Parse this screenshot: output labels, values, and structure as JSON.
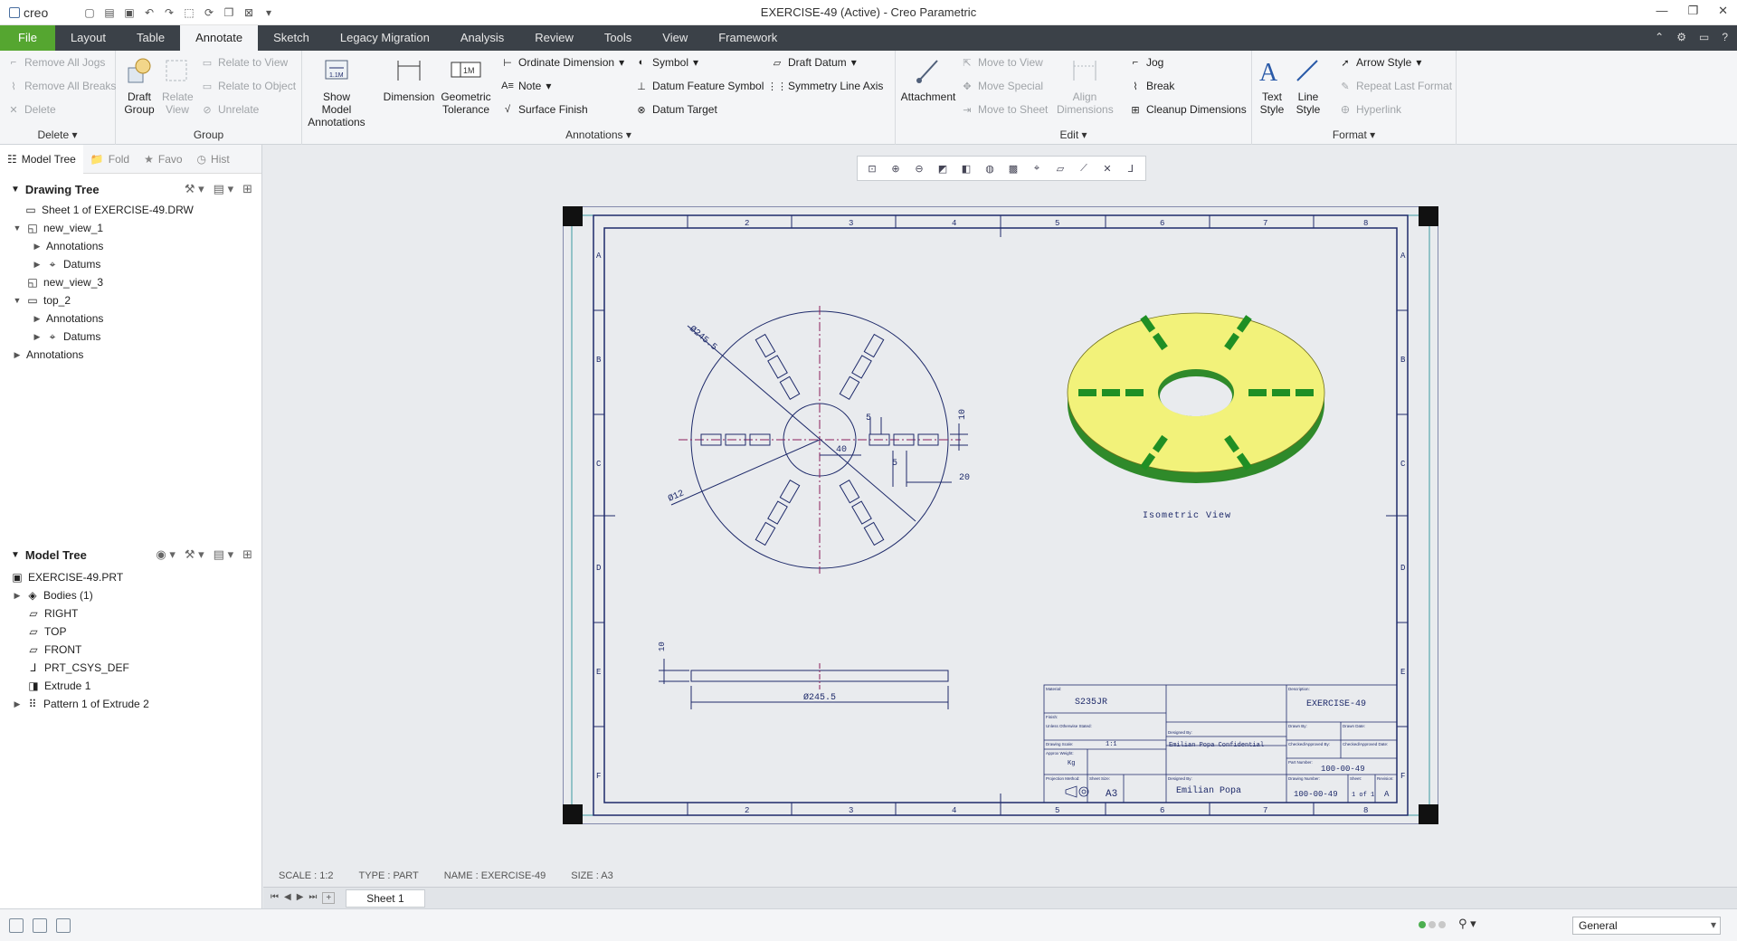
{
  "app": {
    "logo": "creo",
    "window_title": "EXERCISE-49 (Active) - Creo Parametric"
  },
  "tabs": [
    "File",
    "Layout",
    "Table",
    "Annotate",
    "Sketch",
    "Legacy Migration",
    "Analysis",
    "Review",
    "Tools",
    "View",
    "Framework"
  ],
  "ribbon": {
    "delete_group": {
      "label": "Delete",
      "items": [
        "Remove All Jogs",
        "Remove All Breaks",
        "Delete"
      ]
    },
    "group_group": {
      "label": "Group",
      "draft_group": "Draft Group",
      "relate_view": "Relate View",
      "relate_to_view": "Relate to View",
      "relate_to_object": "Relate to Object",
      "unrelate": "Unrelate"
    },
    "annotations_group": {
      "label": "Annotations",
      "show_model_annotations": "Show Model Annotations",
      "dimension": "Dimension",
      "geometric_tolerance": "Geometric Tolerance",
      "ordinate_dimension": "Ordinate Dimension",
      "note": "Note",
      "surface_finish": "Surface Finish",
      "symbol": "Symbol",
      "datum_feature_symbol": "Datum Feature Symbol",
      "datum_target": "Datum Target",
      "draft_datum": "Draft Datum",
      "symmetry_line_axis": "Symmetry Line Axis"
    },
    "edit_group": {
      "label": "Edit",
      "attachment": "Attachment",
      "move_to_view": "Move to View",
      "move_special": "Move Special",
      "move_to_sheet": "Move to Sheet",
      "align_dimensions": "Align Dimensions",
      "jog": "Jog",
      "break": "Break",
      "cleanup_dimensions": "Cleanup Dimensions"
    },
    "format_group": {
      "label": "Format",
      "text_style": "Text Style",
      "line_style": "Line Style",
      "arrow_style": "Arrow Style",
      "repeat_last_format": "Repeat Last Format",
      "hyperlink": "Hyperlink"
    }
  },
  "nav_tabs": [
    "Model Tree",
    "Fold",
    "Favo",
    "Hist"
  ],
  "drawing_tree": {
    "title": "Drawing Tree",
    "items": [
      {
        "label": "Sheet 1 of EXERCISE-49.DRW",
        "level": 0
      },
      {
        "label": "new_view_1",
        "level": 0
      },
      {
        "label": "Annotations",
        "level": 1
      },
      {
        "label": "Datums",
        "level": 1
      },
      {
        "label": "new_view_3",
        "level": 0
      },
      {
        "label": "top_2",
        "level": 0
      },
      {
        "label": "Annotations",
        "level": 1
      },
      {
        "label": "Datums",
        "level": 1
      },
      {
        "label": "Annotations",
        "level": 0
      }
    ]
  },
  "model_tree": {
    "title": "Model Tree",
    "items": [
      {
        "label": "EXERCISE-49.PRT"
      },
      {
        "label": "Bodies (1)"
      },
      {
        "label": "RIGHT"
      },
      {
        "label": "TOP"
      },
      {
        "label": "FRONT"
      },
      {
        "label": "PRT_CSYS_DEF"
      },
      {
        "label": "Extrude 1"
      },
      {
        "label": "Pattern 1 of Extrude 2"
      }
    ]
  },
  "drawing": {
    "columns": [
      "1",
      "2",
      "3",
      "4",
      "5",
      "6",
      "7",
      "8"
    ],
    "rows": [
      "A",
      "B",
      "C",
      "D",
      "E",
      "F"
    ],
    "dims": {
      "dia_outer": "Ø245.5",
      "dia_small": "Ø12",
      "r40": "40",
      "d5a": "5",
      "d5b": "5",
      "d20": "20",
      "d10": "10",
      "d10b": "10",
      "bottom_dia": "Ø245.5"
    },
    "iso_label": "Isometric View",
    "title_block": {
      "material_lbl": "Material:",
      "material": "S235JR",
      "finish_lbl": "Finish:",
      "general_tol": "Unless Otherwise Stated:",
      "scale_lbl": "Drawing Scale:",
      "scale": "1:1",
      "mass_lbl": "Approx Weight:",
      "mass": "Kg",
      "proj_lbl": "Projection Method:",
      "sheet_size_lbl": "Sheet Size:",
      "sheet_size": "A3",
      "designer_lbl": "Designed By:",
      "designer": "Emilian Popa",
      "confidential": "Emilian Popa Confidential",
      "description_lbl": "Description:",
      "description": "EXERCISE-49",
      "part_no_lbl": "Part Number:",
      "part_no": "100-00-49",
      "drawing_no_lbl": "Drawing Number:",
      "drawing_no": "100-00-49",
      "sheet_lbl": "Sheet:",
      "sheet": "1 of 1",
      "rev_lbl": "Revision:",
      "rev": "A",
      "drawn_by_lbl": "Drawn By:",
      "date_lbl": "Drawn Date:",
      "checked_lbl": "Checked By:",
      "checked_date_lbl": "Checked Date:",
      "approved_lbl": "Checked/Approved By:",
      "approved_date_lbl": "Checked/Approved Date:"
    }
  },
  "sheet_info": {
    "scale": "SCALE : 1:2",
    "type": "TYPE : PART",
    "name": "NAME : EXERCISE-49",
    "size": "SIZE : A3"
  },
  "sheet_tab": "Sheet 1",
  "status": {
    "filter": "General"
  },
  "colors": {
    "file_tab": "#55a630",
    "dark_tab_bar": "#3b4148",
    "drawing_lines": "#1e2a6a",
    "iso_face": "#f2f27a",
    "iso_side": "#2f8a2a",
    "slot": "#1f8f24"
  }
}
